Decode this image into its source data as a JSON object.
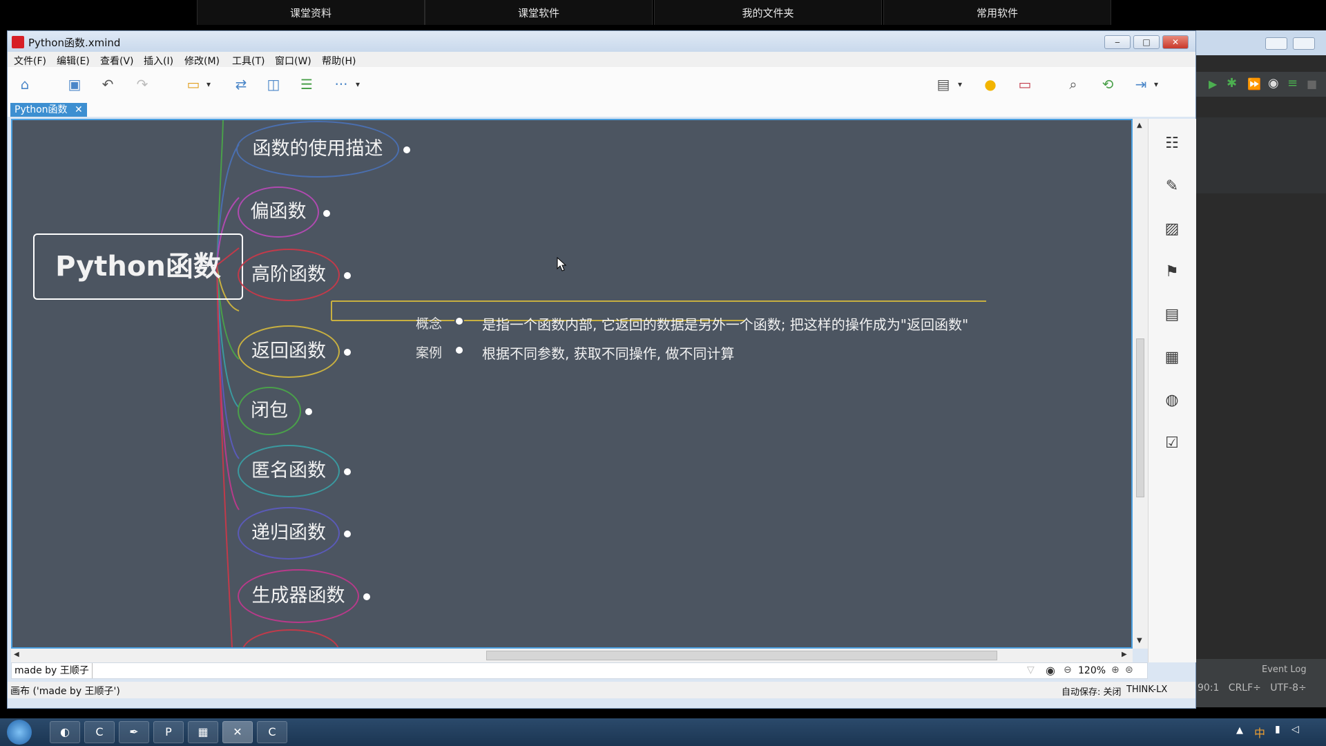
{
  "top_tabs": [
    "课堂资料",
    "课堂软件",
    "我的文件夹",
    "常用软件"
  ],
  "window": {
    "title": "Python函数.xmind",
    "minimize": "‒",
    "maximize": "□",
    "close": "✕"
  },
  "menu": [
    "文件(F)",
    "编辑(E)",
    "查看(V)",
    "插入(I)",
    "修改(M)",
    "工具(T)",
    "窗口(W)",
    "帮助(H)"
  ],
  "toolbar": {
    "left_icons": [
      "home-icon",
      "save-icon",
      "undo-icon",
      "redo-icon",
      "topic-icon",
      "relationship-icon",
      "boundary-icon",
      "summary-icon",
      "more-icon"
    ],
    "right_icons": [
      "presentation-icon",
      "idea-icon",
      "style-icon",
      "search-icon",
      "share-icon",
      "export-icon"
    ],
    "more_glyph": "···"
  },
  "doc_tab": {
    "label": "Python函数",
    "close": "✕"
  },
  "mindmap": {
    "central": "Python函数",
    "topics": [
      {
        "label": "函数的使用描述",
        "color": "#4a6fb0"
      },
      {
        "label": "偏函数",
        "color": "#b04ab0"
      },
      {
        "label": "高阶函数",
        "color": "#c23a4a"
      },
      {
        "label": "返回函数",
        "color": "#c8b040"
      },
      {
        "label": "闭包",
        "color": "#4aa04a"
      },
      {
        "label": "匿名函数",
        "color": "#3a9aa0"
      },
      {
        "label": "递归函数",
        "color": "#5a5ab8"
      },
      {
        "label": "生成器函数",
        "color": "#b83a8a"
      }
    ],
    "subtopics": [
      {
        "label": "概念",
        "detail": "是指一个函数内部, 它返回的数据是另外一个函数; 把这样的操作成为\"返回函数\""
      },
      {
        "label": "案例",
        "detail": "根据不同参数, 获取不同操作, 做不同计算"
      }
    ]
  },
  "footer": {
    "sheet_name": "made by 王顺子",
    "zoom": "120%"
  },
  "status": {
    "left": "画布 ('made by 王顺子')",
    "autosave": "自动保存: 关闭",
    "user": "THINK-LX"
  },
  "right_window": {
    "event_log": "Event Log",
    "status_text": "90:1   CRLF÷   UTF-8÷"
  },
  "taskbar_icons": [
    "start-icon",
    "firefox-icon",
    "camtasia-icon",
    "feather-icon",
    "pycharm-icon",
    "notepad-icon",
    "xmind-icon",
    "recorder-icon"
  ]
}
